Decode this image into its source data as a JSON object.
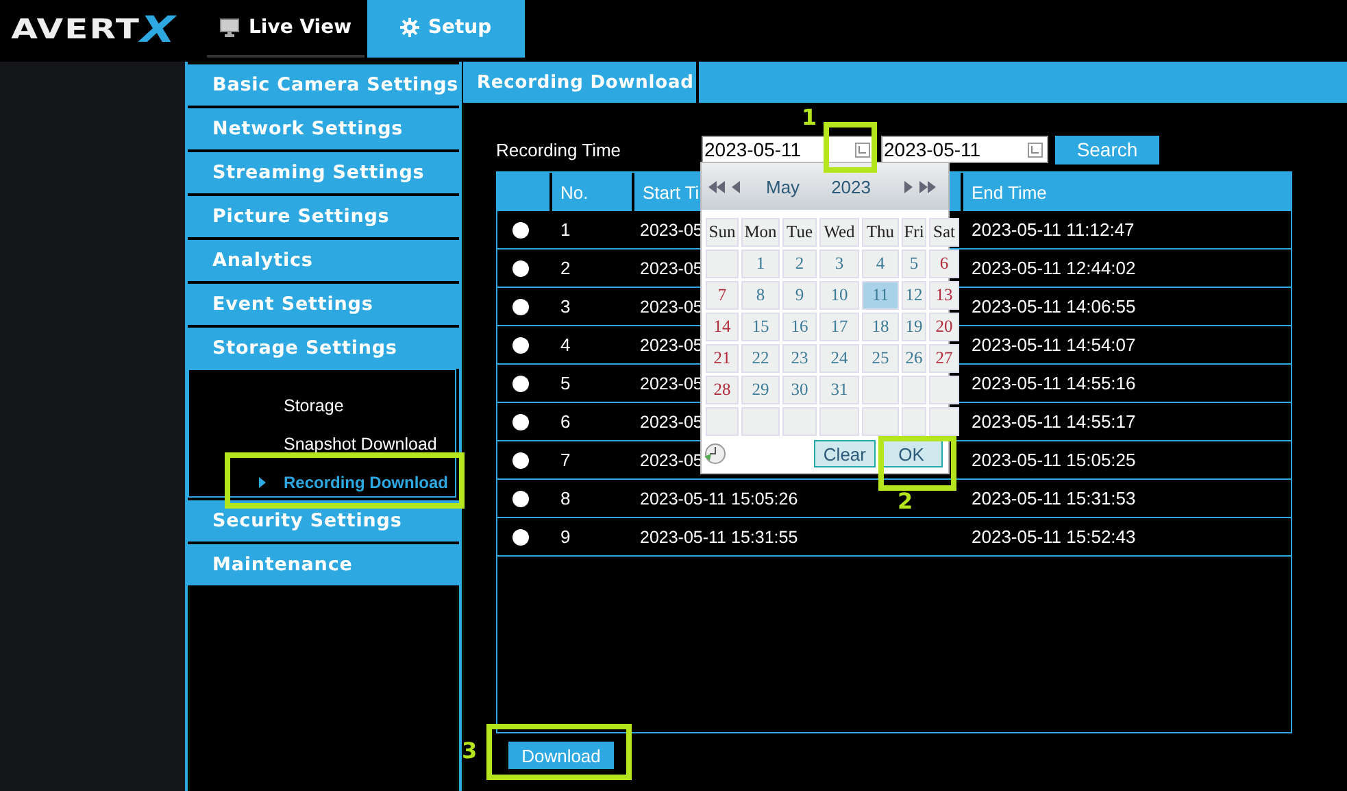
{
  "logo": {
    "text": "AVERT",
    "accent": "X"
  },
  "top_tabs": [
    {
      "label": "Live View",
      "selected": false
    },
    {
      "label": "Setup",
      "selected": true
    }
  ],
  "sidebar": {
    "items": [
      {
        "label": "Basic Camera Settings"
      },
      {
        "label": "Network Settings"
      },
      {
        "label": "Streaming Settings"
      },
      {
        "label": "Picture Settings"
      },
      {
        "label": "Analytics"
      },
      {
        "label": "Event Settings"
      },
      {
        "label": "Storage Settings",
        "children": [
          {
            "label": "Storage",
            "selected": false
          },
          {
            "label": "Snapshot Download",
            "selected": false
          },
          {
            "label": "Recording Download",
            "selected": true
          }
        ]
      },
      {
        "label": "Security Settings"
      },
      {
        "label": "Maintenance"
      }
    ]
  },
  "page_tab": "Recording Download",
  "filter": {
    "label": "Recording Time",
    "start": "2023-05-11",
    "end": "2023-05-11",
    "button": "Search"
  },
  "table": {
    "columns": [
      "No.",
      "Start Ti",
      "End Time"
    ],
    "rows": [
      {
        "selected": false,
        "no": "1",
        "start": "2023-05",
        "end": "2023-05-11 11:12:47"
      },
      {
        "selected": false,
        "no": "2",
        "start": "2023-05",
        "end": "2023-05-11 12:44:02"
      },
      {
        "selected": false,
        "no": "3",
        "start": "2023-05",
        "end": "2023-05-11 14:06:55"
      },
      {
        "selected": false,
        "no": "4",
        "start": "2023-05",
        "end": "2023-05-11 14:54:07"
      },
      {
        "selected": false,
        "no": "5",
        "start": "2023-05",
        "end": "2023-05-11 14:55:16"
      },
      {
        "selected": false,
        "no": "6",
        "start": "2023-05",
        "end": "2023-05-11 14:55:17"
      },
      {
        "selected": false,
        "no": "7",
        "start": "2023-05",
        "end": "2023-05-11 15:05:25"
      },
      {
        "selected": false,
        "no": "8",
        "start": "2023-05-11 15:05:26",
        "end": "2023-05-11 15:31:53"
      },
      {
        "selected": false,
        "no": "9",
        "start": "2023-05-11 15:31:55",
        "end": "2023-05-11 15:52:43"
      }
    ]
  },
  "download_button": "Download",
  "calendar": {
    "month": "May",
    "year": "2023",
    "weekdays": [
      "Sun",
      "Mon",
      "Tue",
      "Wed",
      "Thu",
      "Fri",
      "Sat"
    ],
    "weeks": [
      [
        {
          "kind": "blank"
        },
        {
          "kind": "day",
          "text": "1",
          "selected": false
        },
        {
          "kind": "day",
          "text": "2",
          "selected": false
        },
        {
          "kind": "day",
          "text": "3",
          "selected": false
        },
        {
          "kind": "day",
          "text": "4",
          "selected": false
        },
        {
          "kind": "day",
          "text": "5",
          "selected": false
        },
        {
          "kind": "day",
          "text": "6",
          "selected": false
        }
      ],
      [
        {
          "kind": "day",
          "text": "7",
          "selected": false
        },
        {
          "kind": "day",
          "text": "8",
          "selected": false
        },
        {
          "kind": "day",
          "text": "9",
          "selected": false
        },
        {
          "kind": "day",
          "text": "10",
          "selected": false
        },
        {
          "kind": "day",
          "text": "11",
          "selected": true
        },
        {
          "kind": "day",
          "text": "12",
          "selected": false
        },
        {
          "kind": "day",
          "text": "13",
          "selected": false
        }
      ],
      [
        {
          "kind": "day",
          "text": "14",
          "selected": false
        },
        {
          "kind": "day",
          "text": "15",
          "selected": false
        },
        {
          "kind": "day",
          "text": "16",
          "selected": false
        },
        {
          "kind": "day",
          "text": "17",
          "selected": false
        },
        {
          "kind": "day",
          "text": "18",
          "selected": false
        },
        {
          "kind": "day",
          "text": "19",
          "selected": false
        },
        {
          "kind": "day",
          "text": "20",
          "selected": false
        }
      ],
      [
        {
          "kind": "day",
          "text": "21",
          "selected": false
        },
        {
          "kind": "day",
          "text": "22",
          "selected": false
        },
        {
          "kind": "day",
          "text": "23",
          "selected": false
        },
        {
          "kind": "day",
          "text": "24",
          "selected": false
        },
        {
          "kind": "day",
          "text": "25",
          "selected": false
        },
        {
          "kind": "day",
          "text": "26",
          "selected": false
        },
        {
          "kind": "day",
          "text": "27",
          "selected": false
        }
      ],
      [
        {
          "kind": "day",
          "text": "28",
          "selected": false
        },
        {
          "kind": "day",
          "text": "29",
          "selected": false
        },
        {
          "kind": "day",
          "text": "30",
          "selected": false
        },
        {
          "kind": "day",
          "text": "31",
          "selected": false
        },
        {
          "kind": "blank"
        },
        {
          "kind": "blank"
        },
        {
          "kind": "blank"
        }
      ],
      [
        {
          "kind": "blank"
        },
        {
          "kind": "blank"
        },
        {
          "kind": "blank"
        },
        {
          "kind": "blank"
        },
        {
          "kind": "blank"
        },
        {
          "kind": "blank"
        },
        {
          "kind": "blank"
        }
      ]
    ],
    "buttons": [
      "Clear",
      "OK"
    ]
  },
  "annotations": [
    {
      "kind": "numbered",
      "label": "1"
    },
    {
      "kind": "numbered",
      "label": "2"
    },
    {
      "kind": "numbered",
      "label": "3"
    },
    {
      "kind": "box"
    }
  ]
}
